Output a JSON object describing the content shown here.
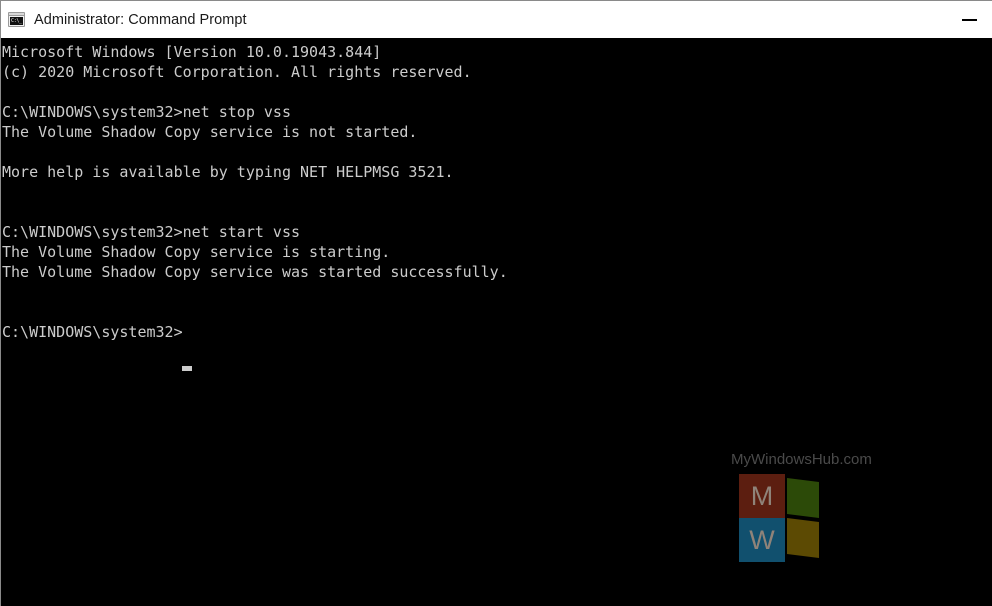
{
  "window": {
    "title": "Administrator: Command Prompt",
    "icon_name": "command-prompt-icon",
    "icon_text": "C:\\_",
    "background_color": "#000000",
    "titlebar_color": "#ffffff"
  },
  "titlebar_buttons": [
    {
      "name": "minimize-button",
      "label": "—",
      "glyph": "minimize"
    }
  ],
  "console": {
    "foreground_color": "#cccccc",
    "background_color": "#000000",
    "cursor": "_",
    "text": "Microsoft Windows [Version 10.0.19043.844]\n(c) 2020 Microsoft Corporation. All rights reserved.\n\nC:\\WINDOWS\\system32>net stop vss\nThe Volume Shadow Copy service is not started.\n\nMore help is available by typing NET HELPMSG 3521.\n\n\nC:\\WINDOWS\\system32>net start vss\nThe Volume Shadow Copy service is starting.\nThe Volume Shadow Copy service was started successfully.\n\n\nC:\\WINDOWS\\system32>",
    "lines": [
      "Microsoft Windows [Version 10.0.19043.844]",
      "(c) 2020 Microsoft Corporation. All rights reserved.",
      "",
      "C:\\WINDOWS\\system32>net stop vss",
      "The Volume Shadow Copy service is not started.",
      "",
      "More help is available by typing NET HELPMSG 3521.",
      "",
      "",
      "C:\\WINDOWS\\system32>net start vss",
      "The Volume Shadow Copy service is starting.",
      "The Volume Shadow Copy service was started successfully.",
      "",
      "",
      "C:\\WINDOWS\\system32>"
    ]
  },
  "watermark": {
    "text": "MyWindowsHub.com",
    "logo_letters": {
      "top": "M",
      "bottom": "W"
    },
    "colors": {
      "red": "#5c1e10",
      "blue": "#11506e",
      "green": "#2c4a08",
      "gold": "#5c4a03",
      "text": "#4a4a4a"
    }
  }
}
